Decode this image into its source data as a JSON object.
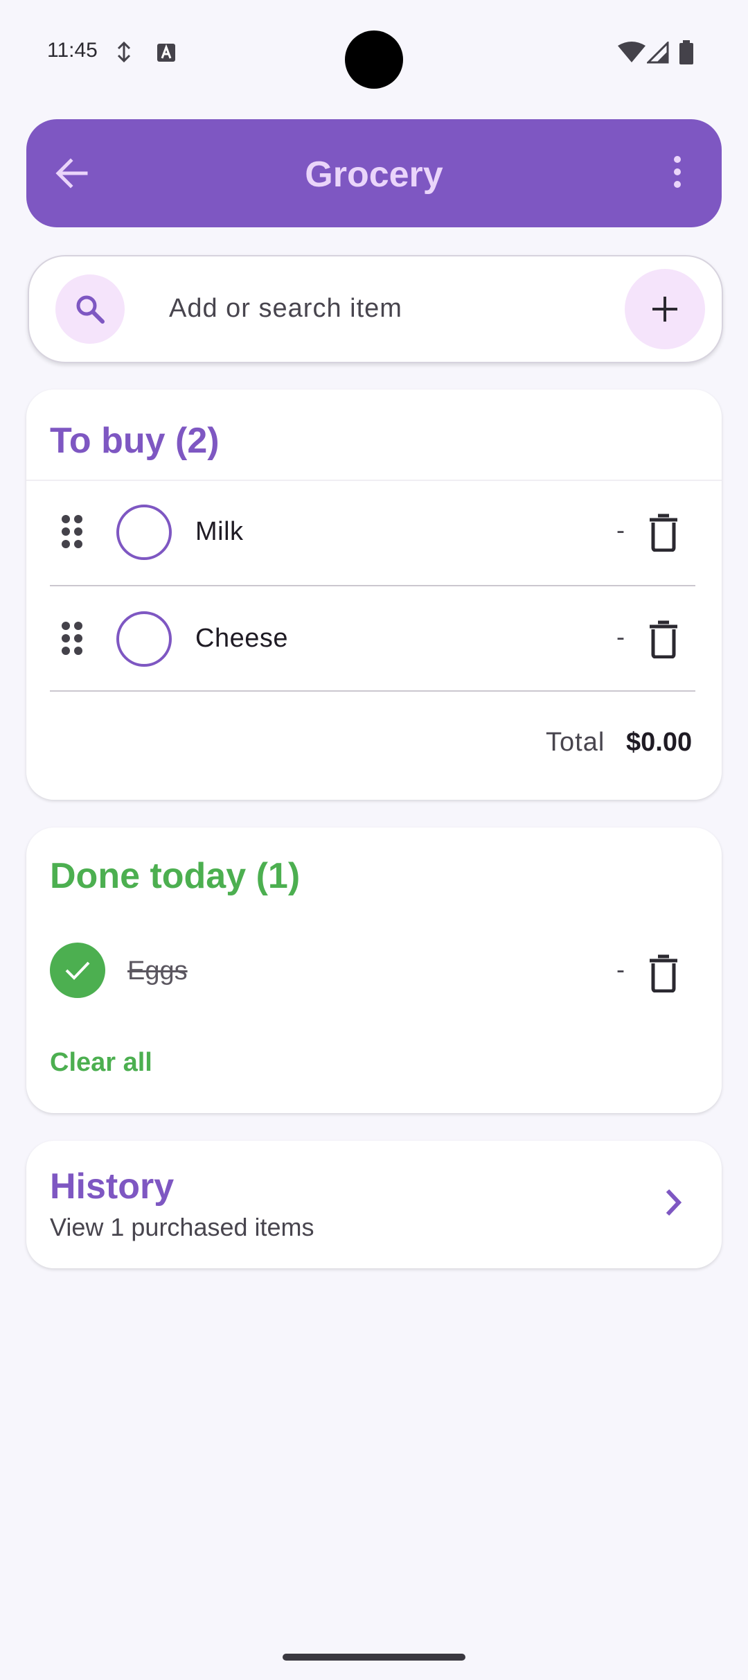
{
  "status_bar": {
    "time": "11:45",
    "icons": [
      "wifi-icon",
      "signal-icon",
      "battery-icon"
    ]
  },
  "app_bar": {
    "title": "Grocery",
    "back_icon": "arrow-back-icon",
    "menu_icon": "more-vert-icon"
  },
  "search": {
    "placeholder": "Add or search item",
    "search_icon": "search-icon",
    "add_icon": "add-icon"
  },
  "to_buy": {
    "title": "To buy (2)",
    "items": [
      {
        "name": "Milk",
        "price": "-"
      },
      {
        "name": "Cheese",
        "price": "-"
      }
    ],
    "total_label": "Total",
    "total_value": "$0.00"
  },
  "done_today": {
    "title": "Done today (1)",
    "items": [
      {
        "name": "Eggs",
        "price": "-"
      }
    ],
    "clear_all": "Clear all"
  },
  "history": {
    "title": "History",
    "subtitle": "View 1 purchased items"
  },
  "colors": {
    "primary": "#7e57c2",
    "success": "#4caf50",
    "on_primary_title": "#ead5fa",
    "background": "#f7f6fc"
  }
}
